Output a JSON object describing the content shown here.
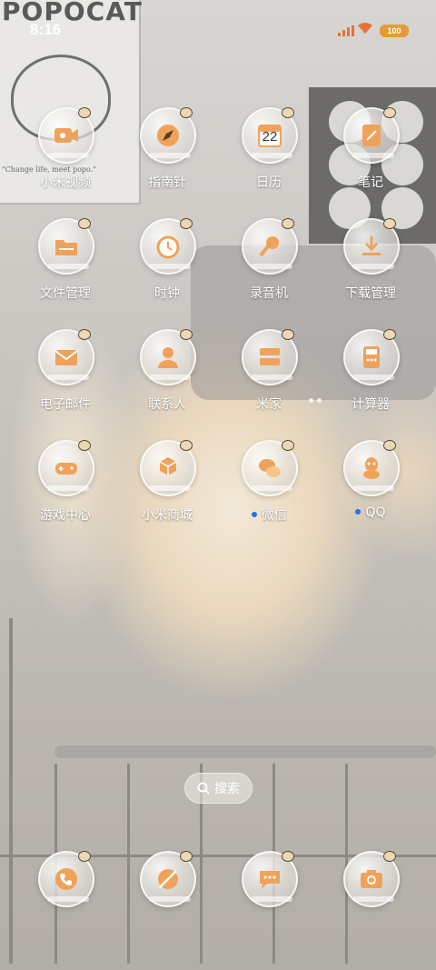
{
  "status_bar": {
    "time": "8:16",
    "battery": "100",
    "icons": [
      "cellular-signal-icon",
      "wifi-icon",
      "battery-icon"
    ],
    "battery_color": "#e39a3a",
    "signal_color": "#e8703a"
  },
  "wallpaper": {
    "poster_title": "POPOCAT",
    "poster_caption": "\"Change life, meet popo.\""
  },
  "apps": [
    {
      "label": "小米视频",
      "icon": "video-icon",
      "notified": false
    },
    {
      "label": "指南针",
      "icon": "compass-icon",
      "notified": false
    },
    {
      "label": "日历",
      "icon": "calendar-icon",
      "notified": false,
      "badge": "22"
    },
    {
      "label": "笔记",
      "icon": "notes-icon",
      "notified": false
    },
    {
      "label": "文件管理",
      "icon": "folder-icon",
      "notified": false
    },
    {
      "label": "时钟",
      "icon": "clock-icon",
      "notified": false
    },
    {
      "label": "录音机",
      "icon": "microphone-icon",
      "notified": false
    },
    {
      "label": "下载管理",
      "icon": "download-icon",
      "notified": false
    },
    {
      "label": "电子邮件",
      "icon": "mail-icon",
      "notified": false
    },
    {
      "label": "联系人",
      "icon": "contacts-icon",
      "notified": false
    },
    {
      "label": "米家",
      "icon": "smart-home-icon",
      "notified": false
    },
    {
      "label": "计算器",
      "icon": "calculator-icon",
      "notified": false
    },
    {
      "label": "游戏中心",
      "icon": "gamepad-icon",
      "notified": false
    },
    {
      "label": "小米商城",
      "icon": "store-icon",
      "notified": false
    },
    {
      "label": "微信",
      "icon": "wechat-icon",
      "notified": true
    },
    {
      "label": "QQ",
      "icon": "qq-icon",
      "notified": true
    }
  ],
  "search": {
    "label": "搜索"
  },
  "dock": [
    {
      "icon": "phone-icon"
    },
    {
      "icon": "browser-icon"
    },
    {
      "icon": "messages-icon"
    },
    {
      "icon": "camera-icon"
    }
  ],
  "colors": {
    "accent_orange": "#e8923a",
    "notification_blue": "#2a6cf0",
    "label_text": "#ffffff"
  }
}
